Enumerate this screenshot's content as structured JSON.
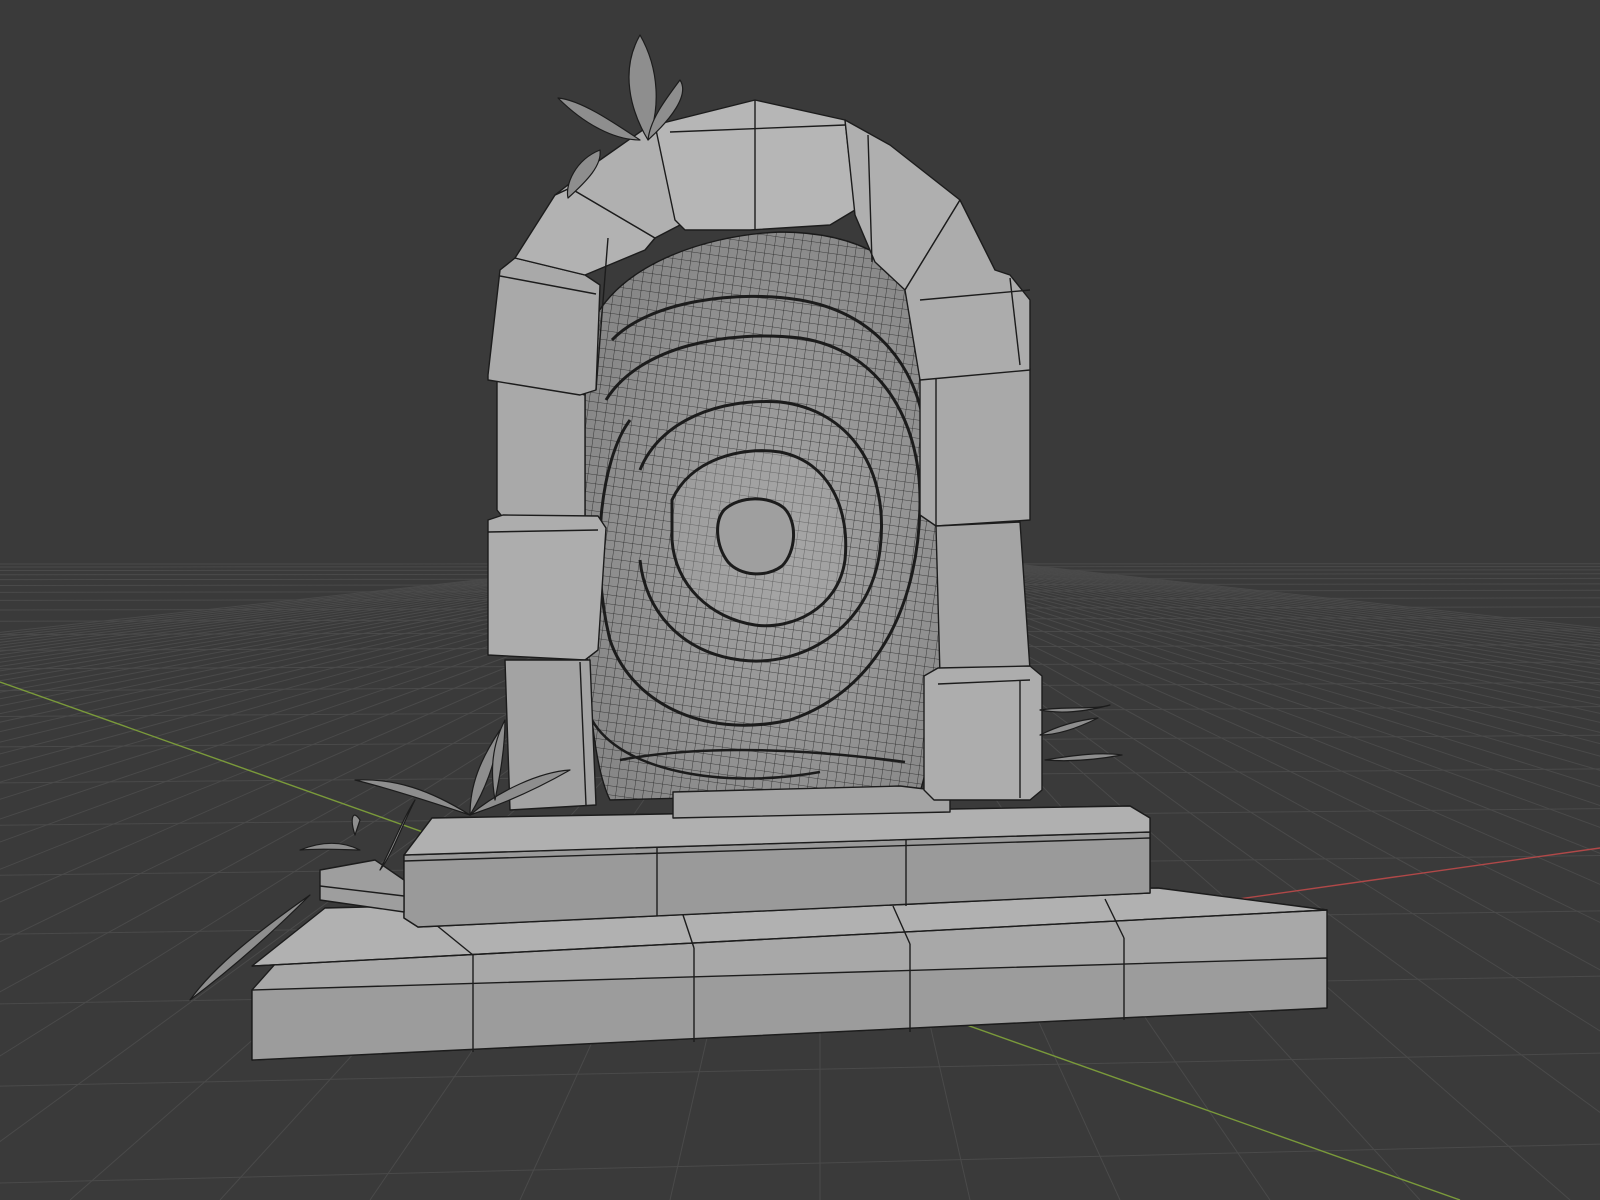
{
  "viewport": {
    "background": "#3a3a3a",
    "grid_color": "#4a4a4a",
    "x_axis_color": "#b04848",
    "y_axis_color": "#7a9a3a",
    "shading": "solid-wireframe",
    "model_color": "#9a9a9a",
    "model_light": "#aeaeae",
    "model_dark": "#7c7c7c",
    "wire_color": "#1c1c1c"
  },
  "scene": {
    "object": "stone-portal-arch",
    "parts": [
      "base-step",
      "plinth",
      "left-pillar",
      "right-pillar",
      "arch-keystones",
      "swirl-portal",
      "leaves"
    ]
  }
}
